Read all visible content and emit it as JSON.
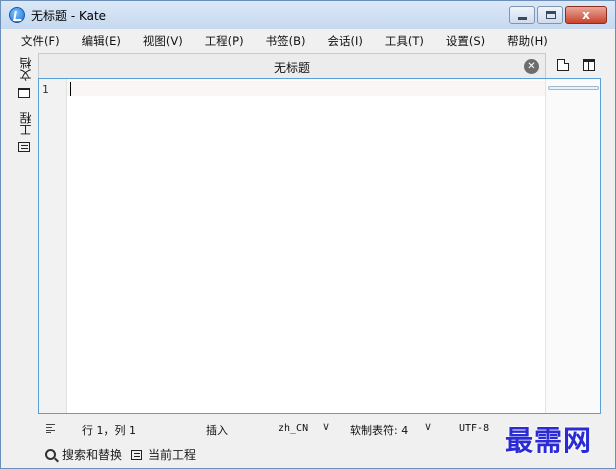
{
  "window": {
    "title": "无标题  - Kate",
    "close_glyph": "x"
  },
  "menubar": {
    "items": [
      "文件(F)",
      "编辑(E)",
      "视图(V)",
      "工程(P)",
      "书签(B)",
      "会话(I)",
      "工具(T)",
      "设置(S)",
      "帮助(H)"
    ]
  },
  "sidebar": {
    "documents_label": "文档",
    "projects_label": "工程"
  },
  "tab": {
    "title": "无标题",
    "close_glyph": "✕"
  },
  "editor": {
    "line_numbers": [
      "1"
    ],
    "content": ""
  },
  "statusbar": {
    "position": "行 1，列 1",
    "mode": "插入",
    "dictionary": "zh_CN",
    "indent": "软制表符: 4",
    "encoding": "UTF-8",
    "chevron": "∨"
  },
  "bottombar": {
    "search_label": "搜索和替换",
    "project_label": "当前工程"
  },
  "watermark": {
    "text": "最需网"
  },
  "colors": {
    "editor_border": "#5aa0d8",
    "watermark": "#2b2bd6",
    "titlebar": "#c6d9ef"
  }
}
